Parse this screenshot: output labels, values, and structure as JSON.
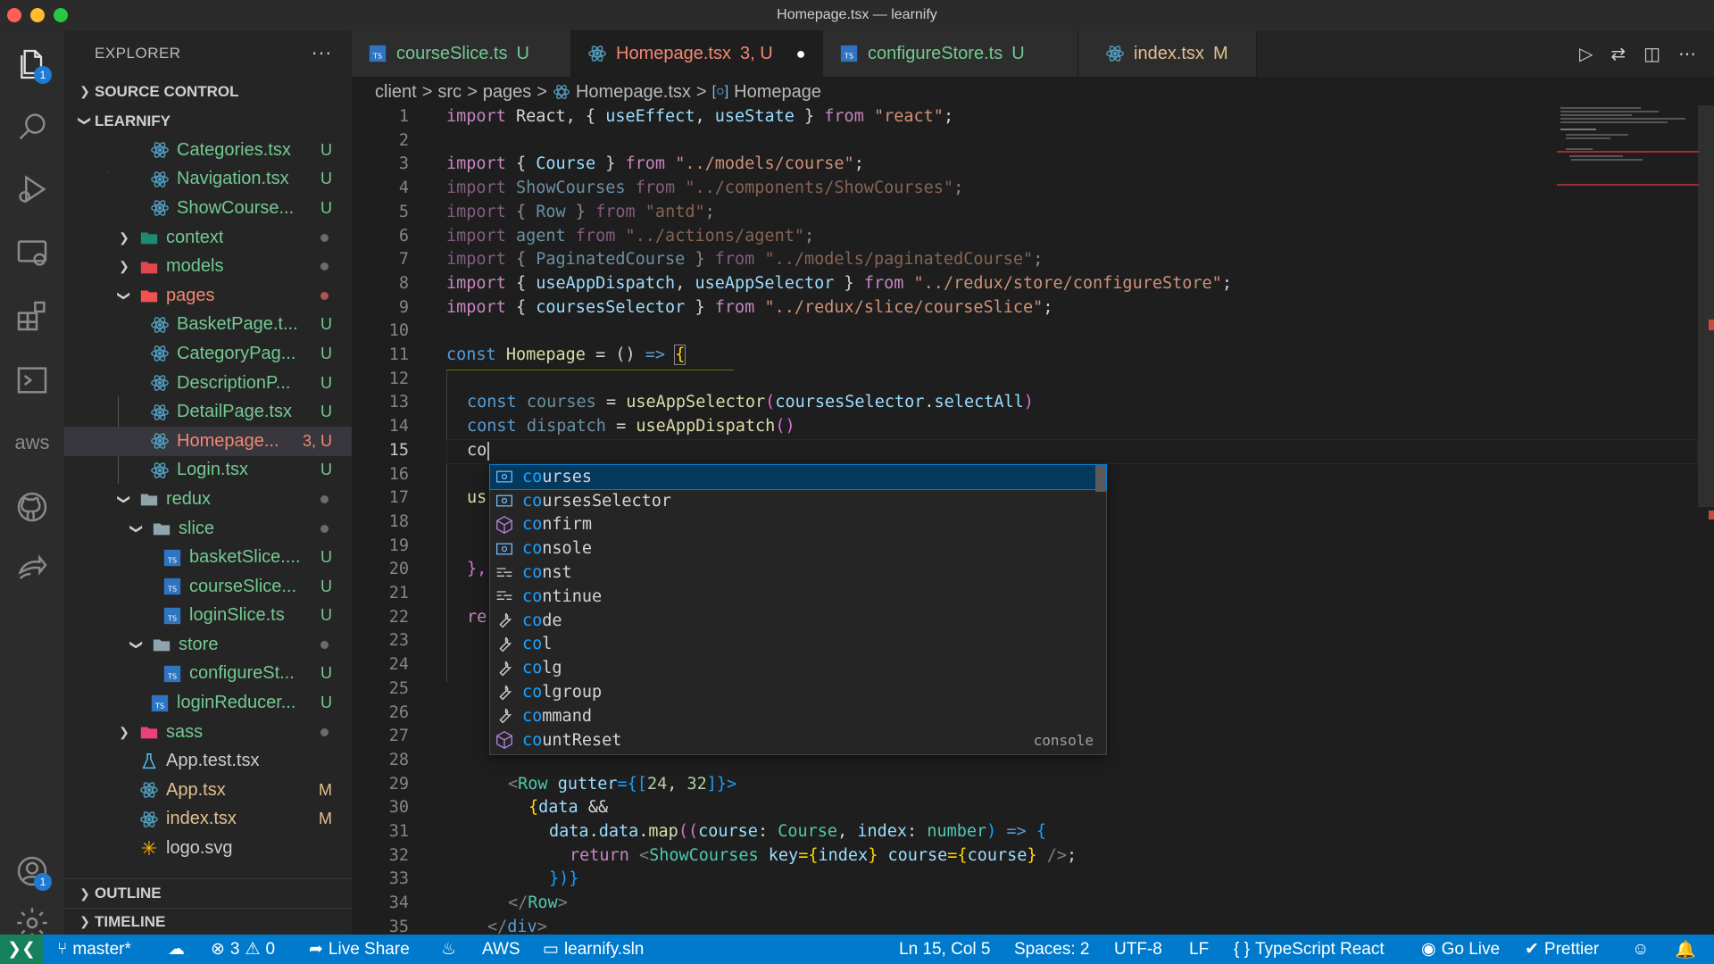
{
  "window": {
    "title": "Homepage.tsx — learnify"
  },
  "colors": {
    "accent": "#007acc",
    "untracked": "#73c991",
    "modified": "#e2c08d",
    "error": "#f48771",
    "selection": "#04395e"
  },
  "activity_bar": {
    "items": [
      {
        "icon": "files-icon",
        "badge": "1"
      },
      {
        "icon": "search-icon"
      },
      {
        "icon": "run-debug-icon"
      },
      {
        "icon": "remote-explorer-icon"
      },
      {
        "icon": "extensions-icon"
      },
      {
        "icon": "terminal-icon"
      },
      {
        "icon": "aws-icon",
        "label": "aws"
      },
      {
        "icon": "github-icon"
      },
      {
        "icon": "live-share-icon"
      }
    ],
    "accounts_badge": "1"
  },
  "sidebar": {
    "title": "EXPLORER",
    "more": "···",
    "source_control": "SOURCE CONTROL",
    "project": "LEARNIFY",
    "outline": "OUTLINE",
    "timeline": "TIMELINE",
    "files": [
      {
        "name": "Categories.tsx",
        "status": "U",
        "type": "react"
      },
      {
        "name": "Navigation.tsx",
        "status": "U",
        "type": "react"
      },
      {
        "name": "ShowCourse...",
        "status": "U",
        "type": "react"
      },
      {
        "name": "context",
        "type": "folder-context"
      },
      {
        "name": "models",
        "type": "folder-models"
      },
      {
        "name": "pages",
        "type": "folder-pages"
      },
      {
        "name": "BasketPage.t...",
        "status": "U",
        "type": "react"
      },
      {
        "name": "CategoryPag...",
        "status": "U",
        "type": "react"
      },
      {
        "name": "DescriptionP...",
        "status": "U",
        "type": "react"
      },
      {
        "name": "DetailPage.tsx",
        "status": "U",
        "type": "react"
      },
      {
        "name": "Homepage...",
        "status": "3, U",
        "type": "react"
      },
      {
        "name": "Login.tsx",
        "status": "U",
        "type": "react"
      },
      {
        "name": "redux",
        "type": "folder"
      },
      {
        "name": "slice",
        "type": "folder"
      },
      {
        "name": "basketSlice....",
        "status": "U",
        "type": "ts"
      },
      {
        "name": "courseSlice...",
        "status": "U",
        "type": "ts"
      },
      {
        "name": "loginSlice.ts",
        "status": "U",
        "type": "ts"
      },
      {
        "name": "store",
        "type": "folder"
      },
      {
        "name": "configureSt...",
        "status": "U",
        "type": "ts"
      },
      {
        "name": "loginReducer...",
        "status": "U",
        "type": "ts"
      },
      {
        "name": "sass",
        "type": "folder-sass"
      },
      {
        "name": "App.test.tsx",
        "type": "test"
      },
      {
        "name": "App.tsx",
        "status": "M",
        "type": "react"
      },
      {
        "name": "index.tsx",
        "status": "M",
        "type": "react"
      },
      {
        "name": "logo.svg",
        "type": "svg"
      }
    ]
  },
  "tabs": [
    {
      "label": "courseSlice.ts",
      "status": "U"
    },
    {
      "label": "Homepage.tsx",
      "status": "3, U",
      "dirty": "●"
    },
    {
      "label": "configureStore.ts",
      "status": "U"
    },
    {
      "label": "index.tsx",
      "status": "M"
    }
  ],
  "breadcrumb": {
    "parts": [
      "client",
      "src",
      "pages",
      "Homepage.tsx",
      "Homepage"
    ],
    "sep": ">"
  },
  "editor": {
    "line_numbers": [
      "1",
      "2",
      "3",
      "4",
      "5",
      "6",
      "7",
      "8",
      "9",
      "10",
      "11",
      "12",
      "13",
      "14",
      "15",
      "16",
      "17",
      "18",
      "19",
      "20",
      "21",
      "22",
      "23",
      "24",
      "25",
      "26",
      "27",
      "28",
      "29",
      "30",
      "31",
      "32",
      "33",
      "34",
      "35"
    ],
    "current_line": "15",
    "lines": {
      "l1": [
        "import",
        " React, { ",
        "useEffect",
        ", ",
        "useState",
        " } ",
        "from",
        " ",
        "\"react\"",
        ";"
      ],
      "l3": [
        "import",
        " { ",
        "Course",
        " } ",
        "from",
        " ",
        "\"../models/course\"",
        ";"
      ],
      "l4": [
        "import",
        " ShowCourses ",
        "from",
        " ",
        "\"../components/ShowCourses\"",
        ";"
      ],
      "l5": [
        "import",
        " { ",
        "Row",
        " } ",
        "from",
        " ",
        "\"antd\"",
        ";"
      ],
      "l6": [
        "import",
        " agent ",
        "from",
        " ",
        "\"../actions/agent\"",
        ";"
      ],
      "l7": [
        "import",
        " { ",
        "PaginatedCourse",
        " } ",
        "from",
        " ",
        "\"../models/paginatedCourse\"",
        ";"
      ],
      "l8": [
        "import",
        " { ",
        "useAppDispatch",
        ", ",
        "useAppSelector",
        " } ",
        "from",
        " ",
        "\"../redux/store/configureStore\"",
        ";"
      ],
      "l9": [
        "import",
        " { ",
        "coursesSelector",
        " } ",
        "from",
        " ",
        "\"../redux/slice/courseSlice\"",
        ";"
      ],
      "l11": [
        "const",
        " ",
        "Homepage",
        " = () ",
        "=>",
        " ",
        "{"
      ],
      "l13": [
        "const",
        " ",
        "courses",
        " = ",
        "useAppSelector",
        "(",
        "coursesSelector",
        ".",
        "selectAll",
        ")"
      ],
      "l14": [
        "const",
        " ",
        "dispatch",
        " = ",
        "useAppDispatch",
        "()"
      ],
      "l15": "co",
      "l17": "us",
      "l20": "},",
      "l22": "re",
      "l29": [
        "<",
        "Row",
        " ",
        "gutter",
        "={[",
        "24",
        ", ",
        "32",
        "]}>"
      ],
      "l30": [
        "{",
        "data",
        " &&"
      ],
      "l31": [
        "data",
        ".",
        "data",
        ".",
        "map",
        "((",
        "course",
        ": ",
        "Course",
        ", ",
        "index",
        ": ",
        "number",
        ") ",
        "=>",
        " {"
      ],
      "l32": [
        "return",
        " <",
        "ShowCourses",
        " ",
        "key",
        "={",
        "index",
        "} ",
        "course",
        "={",
        "course",
        "} ",
        "/>",
        ";"
      ],
      "l33": "})}",
      "l34": [
        "</",
        "Row",
        ">"
      ],
      "l35": [
        "</",
        "div",
        ">"
      ]
    }
  },
  "suggestions": {
    "prefix": "co",
    "items": [
      {
        "label": "courses",
        "match": "co",
        "rest": "urses",
        "kind": "variable"
      },
      {
        "label": "coursesSelector",
        "match": "co",
        "rest": "ursesSelector",
        "kind": "variable"
      },
      {
        "label": "confirm",
        "match": "co",
        "rest": "nfirm",
        "kind": "method"
      },
      {
        "label": "console",
        "match": "co",
        "rest": "nsole",
        "kind": "variable"
      },
      {
        "label": "const",
        "match": "co",
        "rest": "nst",
        "kind": "keyword"
      },
      {
        "label": "continue",
        "match": "co",
        "rest": "ntinue",
        "kind": "keyword"
      },
      {
        "label": "code",
        "match": "co",
        "rest": "de",
        "kind": "snippet"
      },
      {
        "label": "col",
        "match": "co",
        "rest": "l",
        "kind": "snippet"
      },
      {
        "label": "colg",
        "match": "co",
        "rest": "lg",
        "kind": "snippet"
      },
      {
        "label": "colgroup",
        "match": "co",
        "rest": "lgroup",
        "kind": "snippet"
      },
      {
        "label": "command",
        "match": "co",
        "rest": "mmand",
        "kind": "snippet"
      },
      {
        "label": "countReset",
        "match": "co",
        "rest": "untReset",
        "kind": "method",
        "detail": "console"
      }
    ]
  },
  "status_bar": {
    "branch": "master*",
    "errors": "3",
    "warnings": "0",
    "live_share": "Live Share",
    "aws": "AWS",
    "solution": "learnify.sln",
    "cursor": "Ln 15, Col 5",
    "spaces": "Spaces: 2",
    "encoding": "UTF-8",
    "eol": "LF",
    "language": "TypeScript React",
    "go_live": "Go Live",
    "prettier": "Prettier"
  }
}
